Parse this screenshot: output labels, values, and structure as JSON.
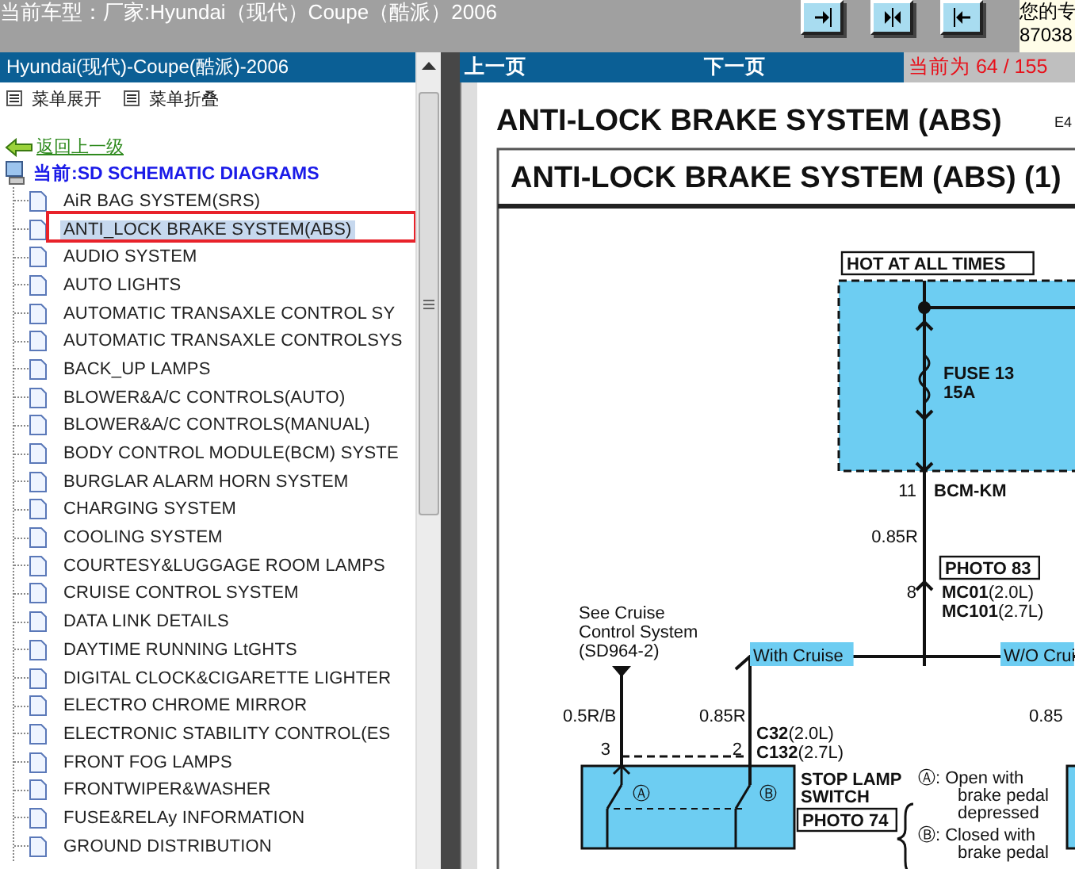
{
  "top_bar": {
    "title": "当前车型：厂家:Hyundai（现代）Coupe（酷派）2006",
    "nav_buttons": [
      {
        "kind": "next"
      },
      {
        "kind": "both"
      },
      {
        "kind": "prev"
      }
    ],
    "notice_lines": [
      "您的专",
      "87038"
    ]
  },
  "sidebar": {
    "header": "Hyundai(现代)-Coupe(酷派)-2006",
    "menu_actions": [
      "菜单展开",
      "菜单折叠"
    ],
    "back_link": "返回上一级",
    "current": "当前:SD SCHEMATIC DIAGRAMS",
    "items": [
      {
        "label": "AiR BAG SYSTEM(SRS)",
        "selected": false
      },
      {
        "label": "ANTI_LOCK BRAKE SYSTEM(ABS)",
        "selected": true
      },
      {
        "label": "AUDIO SYSTEM",
        "selected": false
      },
      {
        "label": "AUTO LIGHTS",
        "selected": false
      },
      {
        "label": "AUTOMATIC TRANSAXLE CONTROL SY",
        "selected": false
      },
      {
        "label": "AUTOMATIC TRANSAXLE CONTROLSYS",
        "selected": false
      },
      {
        "label": "BACK_UP LAMPS",
        "selected": false
      },
      {
        "label": "BLOWER&A/C CONTROLS(AUTO)",
        "selected": false
      },
      {
        "label": "BLOWER&A/C CONTROLS(MANUAL)",
        "selected": false
      },
      {
        "label": "BODY CONTROL MODULE(BCM) SYSTE",
        "selected": false
      },
      {
        "label": "BURGLAR ALARM HORN SYSTEM",
        "selected": false
      },
      {
        "label": "CHARGING SYSTEM",
        "selected": false
      },
      {
        "label": "COOLING SYSTEM",
        "selected": false
      },
      {
        "label": "COURTESY&LUGGAGE ROOM LAMPS",
        "selected": false
      },
      {
        "label": "CRUISE CONTROL SYSTEM",
        "selected": false
      },
      {
        "label": "DATA LINK DETAILS",
        "selected": false
      },
      {
        "label": "DAYTIME RUNNING LtGHTS",
        "selected": false
      },
      {
        "label": "DIGITAL CLOCK&CIGARETTE LIGHTER",
        "selected": false
      },
      {
        "label": "ELECTRO CHROME MIRROR",
        "selected": false
      },
      {
        "label": "ELECTRONIC STABILITY CONTROL(ES",
        "selected": false
      },
      {
        "label": "FRONT FOG LAMPS",
        "selected": false
      },
      {
        "label": "FRONTWIPER&WASHER",
        "selected": false
      },
      {
        "label": "FUSE&RELAy INFORMATION",
        "selected": false
      },
      {
        "label": "GROUND DISTRIBUTION",
        "selected": false
      }
    ]
  },
  "viewer": {
    "prev": "上一页",
    "next": "下一页",
    "page_indicator": "当前为 64 / 155",
    "document": {
      "title": "ANTI-LOCK BRAKE SYSTEM (ABS)",
      "code": "E4",
      "section_title": "ANTI-LOCK BRAKE SYSTEM (ABS) (1)",
      "labels": [
        {
          "kind": "boxed",
          "text": "HOT AT ALL TIMES"
        },
        {
          "kind": "bold",
          "text": "FUSE 13"
        },
        {
          "kind": "bold",
          "text": "15A"
        },
        {
          "kind": "plain",
          "text": "11"
        },
        {
          "kind": "bold",
          "text": "BCM-KM"
        },
        {
          "kind": "plain",
          "text": "0.85R"
        },
        {
          "kind": "boxed",
          "text": "PHOTO 83"
        },
        {
          "kind": "plain",
          "text": "8"
        },
        {
          "kind": "connector",
          "code": "MC01",
          "variant": "(2.0L)"
        },
        {
          "kind": "connector",
          "code": "MC101",
          "variant": "(2.7L)"
        },
        {
          "kind": "tag",
          "text": "With Cruise"
        },
        {
          "kind": "tag",
          "text": "W/O Crui"
        },
        {
          "kind": "plain",
          "text": "See Cruise"
        },
        {
          "kind": "plain",
          "text": "Control System"
        },
        {
          "kind": "plain",
          "text": "(SD964-2)"
        },
        {
          "kind": "plain",
          "text": "0.5R/B"
        },
        {
          "kind": "plain",
          "text": "0.85R"
        },
        {
          "kind": "plain",
          "text": "0.85"
        },
        {
          "kind": "plain",
          "text": "3"
        },
        {
          "kind": "plain",
          "text": "2"
        },
        {
          "kind": "connector",
          "code": "C32",
          "variant": "(2.0L)"
        },
        {
          "kind": "connector",
          "code": "C132",
          "variant": "(2.7L)"
        },
        {
          "kind": "bold",
          "text": "STOP LAMP"
        },
        {
          "kind": "bold",
          "text": "SWITCH"
        },
        {
          "kind": "boxed",
          "text": "PHOTO 74"
        },
        {
          "kind": "plain",
          "text": "Ⓐ: Open with"
        },
        {
          "kind": "plain",
          "text": "brake pedal"
        },
        {
          "kind": "plain",
          "text": "depressed"
        },
        {
          "kind": "plain",
          "text": "Ⓑ: Closed with"
        },
        {
          "kind": "plain",
          "text": "brake pedal"
        },
        {
          "kind": "plain",
          "text": "Ⓐ"
        },
        {
          "kind": "plain",
          "text": "Ⓑ"
        }
      ]
    }
  }
}
